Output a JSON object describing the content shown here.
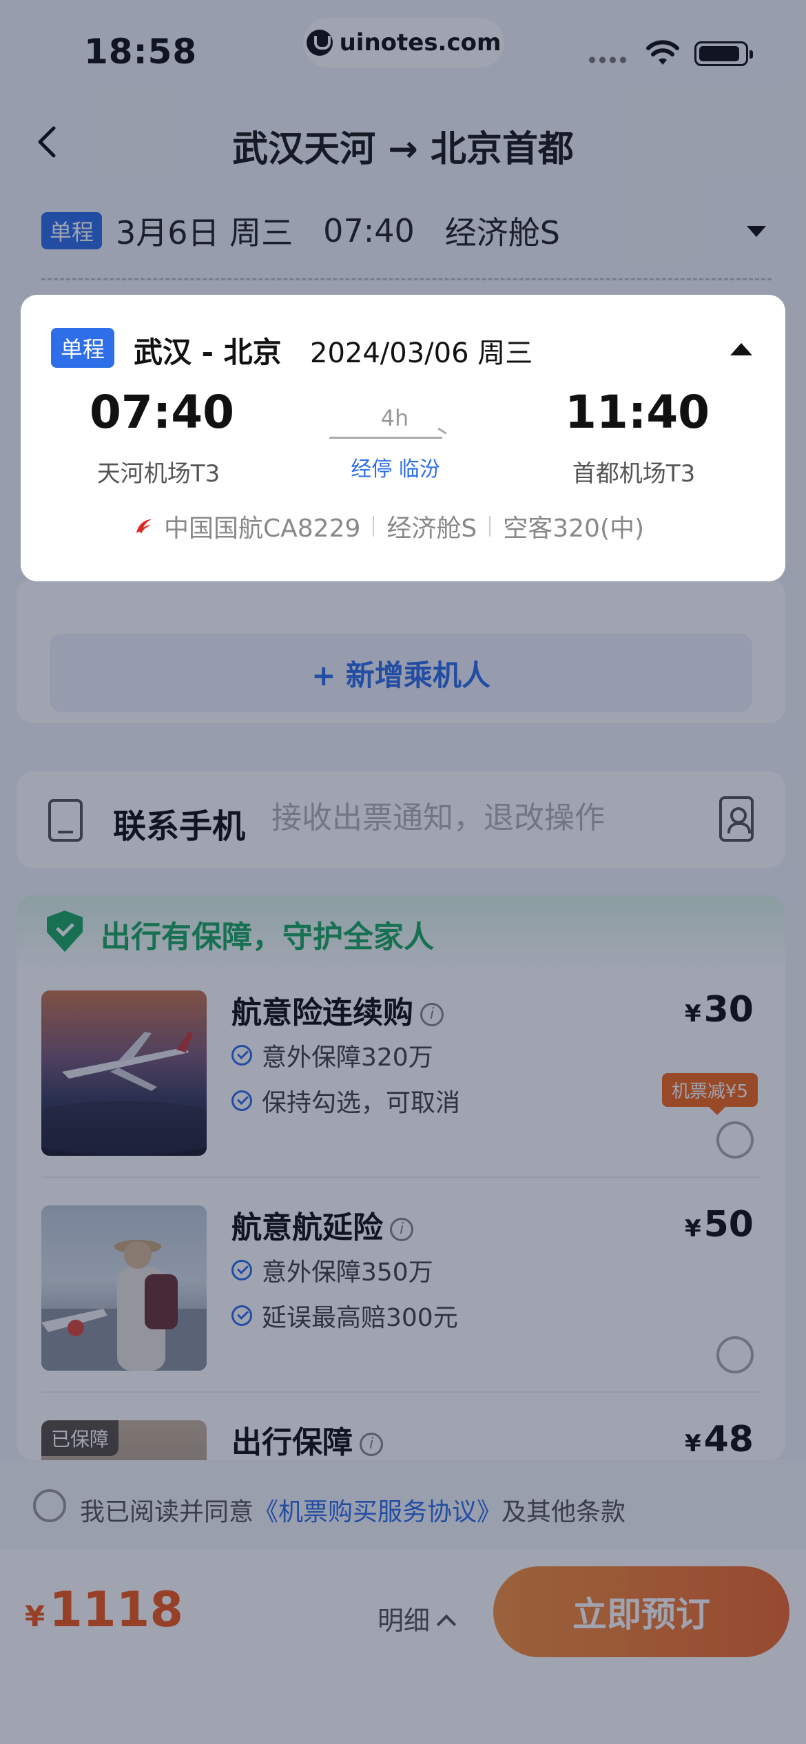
{
  "status_bar": {
    "time": "18:58",
    "watermark": "uinotes.com"
  },
  "nav": {
    "title": "武汉天河 → 北京首都"
  },
  "summary": {
    "trip_type": "单程",
    "date": "3月6日 周三",
    "time": "07:40",
    "cabin": "经济舱S"
  },
  "popup": {
    "trip_type": "单程",
    "route": "武汉 - 北京",
    "date": "2024/03/06 周三",
    "departure_time": "07:40",
    "departure_airport": "天河机场T3",
    "duration": "4h",
    "stopover": "经停 临汾",
    "arrival_time": "11:40",
    "arrival_airport": "首都机场T3",
    "airline_flight": "中国国航CA8229",
    "cabin": "经济舱S",
    "aircraft": "空客320(中)",
    "airline_color": "#d8281f"
  },
  "passenger": {
    "add_label": "+ 新增乘机人"
  },
  "contact": {
    "label": "联系手机",
    "placeholder": "接收出票通知，退改操作"
  },
  "insurance": {
    "section_title": "出行有保障，守护全家人",
    "items": [
      {
        "name": "航意险连续购",
        "currency": "¥",
        "price": "30",
        "features": [
          "意外保障320万",
          "保持勾选，可取消"
        ],
        "promo": "机票减¥5",
        "selected": false
      },
      {
        "name": "航意航延险",
        "currency": "¥",
        "price": "50",
        "features": [
          "意外保障350万",
          "延误最高赔300元"
        ],
        "selected": false
      },
      {
        "name": "出行保障",
        "currency": "¥",
        "price": "48",
        "badge": "已保障"
      }
    ]
  },
  "agreement": {
    "prefix": "我已阅读并同意",
    "link": "《机票购买服务协议》",
    "suffix": "及其他条款"
  },
  "footer": {
    "currency": "¥",
    "total": "1118",
    "detail_label": "明细",
    "book_label": "立即预订"
  },
  "colors": {
    "accent_blue": "#2e6ee8",
    "price_orange": "#ef5b1a",
    "guard_green": "#1aa860",
    "book_button": "#f0692a"
  }
}
